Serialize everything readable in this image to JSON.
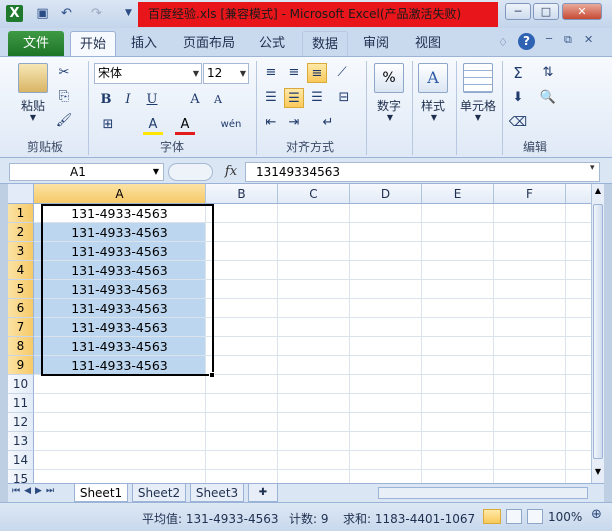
{
  "window": {
    "title": "百度经验.xls [兼容模式] - Microsoft Excel(产品激活失败)",
    "minimize": "─",
    "restore": "□",
    "close": "✕"
  },
  "quick_access": {
    "app_icon": "excel-icon",
    "save_icon": "save-icon",
    "undo_icon": "undo-icon",
    "redo_icon": "redo-icon"
  },
  "ribbon_tabs": [
    "文件",
    "开始",
    "插入",
    "页面布局",
    "公式",
    "数据",
    "审阅",
    "视图"
  ],
  "ribbon": {
    "clipboard": {
      "paste": "粘贴",
      "label": "剪贴板"
    },
    "font": {
      "name": "宋体",
      "size": "12",
      "bold": "B",
      "italic": "I",
      "underline": "U",
      "grow": "A",
      "shrink": "A",
      "fill": "A",
      "color": "A",
      "wen": "wén",
      "label": "字体"
    },
    "alignment": {
      "label": "对齐方式"
    },
    "number": {
      "label": "数字",
      "icon": "%"
    },
    "styles": {
      "label": "样式",
      "icon": "A"
    },
    "cells": {
      "label": "单元格"
    },
    "editing": {
      "label": "编辑",
      "sum": "Σ"
    }
  },
  "formula_bar": {
    "name_box": "A1",
    "fx": "fx",
    "value": "13149334563"
  },
  "columns": [
    "A",
    "B",
    "C",
    "D",
    "E",
    "F"
  ],
  "rows": [
    "1",
    "2",
    "3",
    "4",
    "5",
    "6",
    "7",
    "8",
    "9",
    "10",
    "11",
    "12",
    "13",
    "14",
    "15"
  ],
  "cells_A": [
    "131-4933-4563",
    "131-4933-4563",
    "131-4933-4563",
    "131-4933-4563",
    "131-4933-4563",
    "131-4933-4563",
    "131-4933-4563",
    "131-4933-4563",
    "131-4933-4563"
  ],
  "sheets": [
    "Sheet1",
    "Sheet2",
    "Sheet3"
  ],
  "status": {
    "average": "平均值: 131-4933-4563",
    "count": "计数: 9",
    "sum": "求和: 1183-4401-1067",
    "zoom": "100%"
  },
  "colors": {
    "title_bar_highlight": "#e8161b",
    "file_tab": "#2a8a35",
    "selection_fill": "#bcd6ef"
  }
}
